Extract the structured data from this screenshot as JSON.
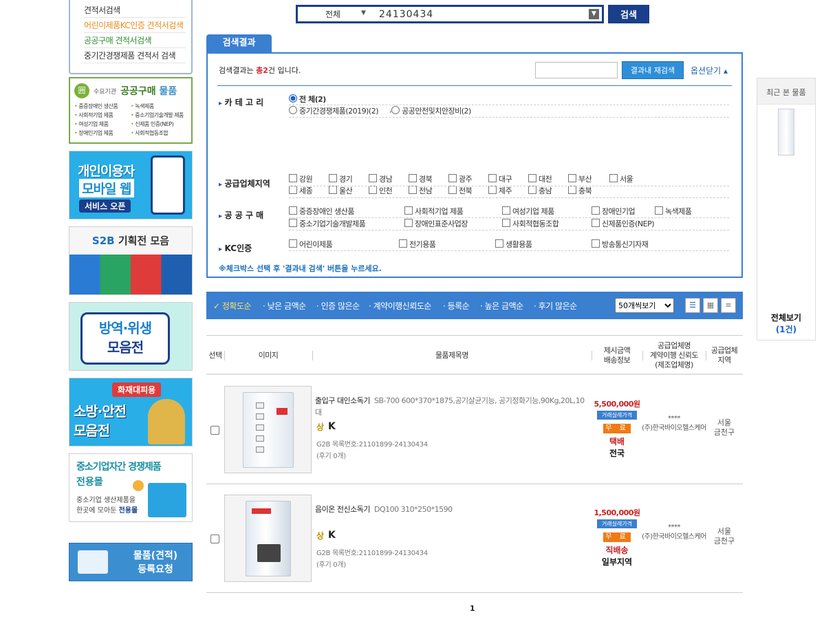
{
  "sidebar": {
    "menu": [
      "견적서검색",
      "어린이제품KC인증 견적서검색",
      "공공구매 견적서검색",
      "중기간경쟁제품 견적서 검색"
    ],
    "public_banner": {
      "coin": "囲",
      "small": "수요기관",
      "big1": "공공구매",
      "big2": "물품",
      "items": [
        "중증장애인 생산품",
        "녹색제품",
        "사회적기업 제품",
        "중소기업기술개발 제품",
        "여성기업 제품",
        "신제품 인증(NEP)",
        "장애인기업 제품",
        "사회적협동조합"
      ]
    },
    "mobile_banner": {
      "line1": "개인이용자",
      "line2": "모바일 웹",
      "line3": "서비스 오픈"
    },
    "s2b_banner": {
      "brand": "S2B",
      "title": "기획전 모음"
    },
    "quarantine_banner": {
      "line1": "방역·위생",
      "line2": "모음전"
    },
    "fire_banner": {
      "tag": "화재대피용",
      "line1": "소방·안전",
      "line2": "모음전"
    },
    "sme_banner": {
      "line1": "중소기업자간 경쟁제품",
      "line2": "전용몰",
      "desc1": "중소기업 생산제품을",
      "desc2": "한곳에 모아둔",
      "desc_bold": "전용몰"
    },
    "register_banner": {
      "line1": "물품(견적)",
      "line2": "등록요청"
    }
  },
  "search": {
    "category": "전체",
    "query": "24130434",
    "button": "검색"
  },
  "result": {
    "tab": "검색결과",
    "summary_pre": "검색결과는 ",
    "summary_count": "총2",
    "summary_post": "건 입니다.",
    "refine_button": "결과내 재검색",
    "options_toggle": "옵션닫기",
    "category_label": "카 테 고 리",
    "categories": [
      "전 체(2)",
      "중기간경쟁제품(2019)(2)",
      "공공안전및치안장비(2)"
    ],
    "region_label": "공급업체지역",
    "regions": [
      "강원",
      "경기",
      "경남",
      "경북",
      "광주",
      "대구",
      "대전",
      "부산",
      "서울",
      "세종",
      "울산",
      "인천",
      "전남",
      "전북",
      "제주",
      "충남",
      "충북"
    ],
    "public_label": "공 공 구 매",
    "public_items": [
      "중증장애인 생산품",
      "사회적기업 제품",
      "여성기업 제품",
      "장애인기업",
      "녹색제품",
      "중소기업기술개발제품",
      "장애인표준사업장",
      "사회적협동조합",
      "신제품인증(NEP)"
    ],
    "kc_label": "KC인증",
    "kc_items": [
      "어린이제품",
      "전기용품",
      "생활용품",
      "방송통신기자재"
    ],
    "notice": "※체크박스 선택 후 '결과내 검색' 버튼을 누르세요."
  },
  "sort": {
    "items": [
      "정확도순",
      "낮은 금액순",
      "인증 많은순",
      "계약이행신뢰도순",
      "등록순",
      "높은 금액순",
      "후기 많은순"
    ],
    "page_size": "50개씩보기"
  },
  "table": {
    "headers": [
      "선택",
      "이미지",
      "물품제목명",
      "제시금액\n배송정보",
      "공급업체명\n계약이행 신뢰도\n(제조업체명)",
      "공급업체\n지역"
    ]
  },
  "products": [
    {
      "title": "출입구 대인소독기",
      "spec": "SB-700  600*370*1875,공기살균기능, 공기정화기능,90Kg,20L,10대",
      "badge1": "상",
      "badge2": "K",
      "g2b": "G2B 목록번호:21101899-24130434",
      "review": "(후기 0개)",
      "price": "5,500,000원",
      "price_tag": "거래실례가격",
      "ship_fee": "무 료",
      "ship_method": "택배",
      "ship_area": "전국",
      "stars": "****",
      "company": "(주)한국바이오헬스케어",
      "region": "서울\n금천구"
    },
    {
      "title": "음이온 전신소독기",
      "spec": "DQ100  310*250*1590",
      "badge1": "상",
      "badge2": "K",
      "g2b": "G2B 목록번호:21101899-24130434",
      "review": "(후기 0개)",
      "price": "1,500,000원",
      "price_tag": "거래실례가격",
      "ship_fee": "무 료",
      "ship_method": "직배송",
      "ship_area": "일부지역",
      "stars": "****",
      "company": "(주)한국바이오헬스케어",
      "region": "서울\n금천구"
    }
  ],
  "pagination": {
    "current": "1"
  },
  "recent": {
    "title": "최근 본 물품",
    "all_label": "전체보기",
    "count": "(1건)"
  }
}
